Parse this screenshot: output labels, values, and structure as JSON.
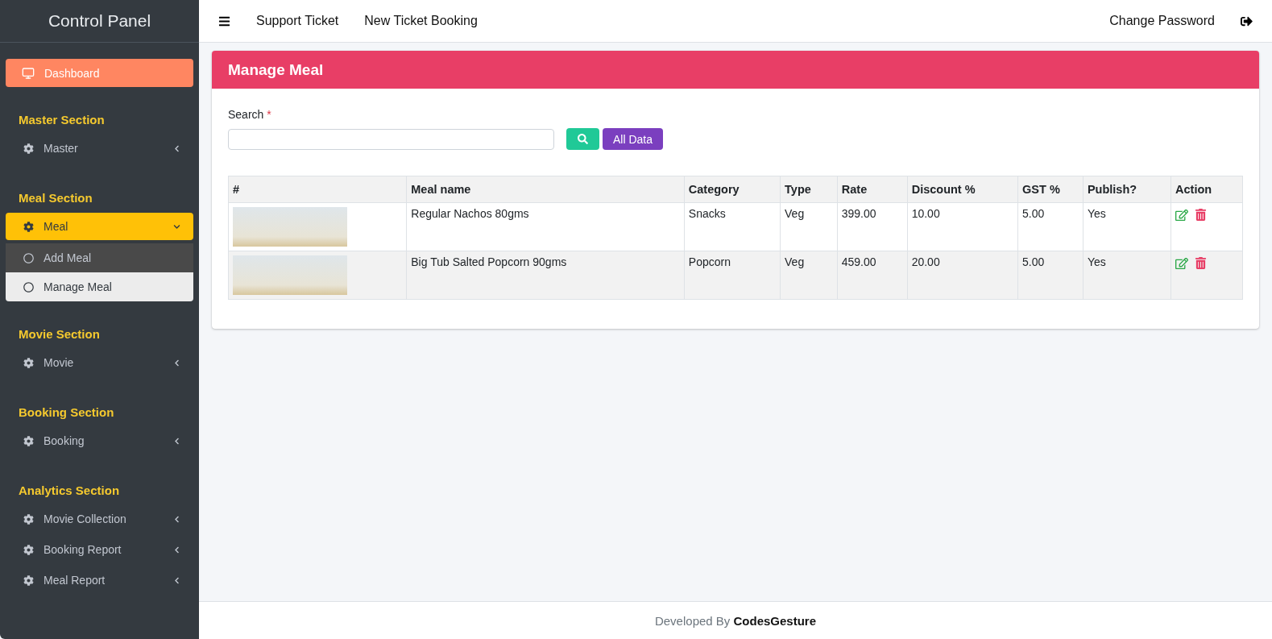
{
  "sidebar": {
    "title": "Control Panel",
    "dashboard": {
      "label": "Dashboard",
      "selected": true
    },
    "sections": [
      {
        "title": "Master Section",
        "items": [
          {
            "label": "Master",
            "expanded": false
          }
        ]
      },
      {
        "title": "Meal Section",
        "items": [
          {
            "label": "Meal",
            "expanded": true,
            "children": [
              {
                "label": "Add Meal",
                "selected": false
              },
              {
                "label": "Manage Meal",
                "selected": true
              }
            ]
          }
        ]
      },
      {
        "title": "Movie Section",
        "items": [
          {
            "label": "Movie",
            "expanded": false
          }
        ]
      },
      {
        "title": "Booking Section",
        "items": [
          {
            "label": "Booking",
            "expanded": false
          }
        ]
      },
      {
        "title": "Analytics Section",
        "items": [
          {
            "label": "Movie Collection",
            "expanded": false
          },
          {
            "label": "Booking Report",
            "expanded": false
          },
          {
            "label": "Meal Report",
            "expanded": false
          }
        ]
      }
    ]
  },
  "topbar": {
    "links": [
      "Support Ticket",
      "New Ticket Booking"
    ],
    "right_link": "Change Password"
  },
  "card": {
    "title": "Manage Meal",
    "search": {
      "label": "Search",
      "required_mark": "*"
    },
    "all_data_button": "All Data",
    "table": {
      "columns": [
        "#",
        "Meal name",
        "Category",
        "Type",
        "Rate",
        "Discount %",
        "GST %",
        "Publish?",
        "Action"
      ],
      "rows": [
        {
          "meal_name": "Regular Nachos 80gms",
          "category": "Snacks",
          "type": "Veg",
          "rate": "399.00",
          "discount": "10.00",
          "gst": "5.00",
          "publish": "Yes"
        },
        {
          "meal_name": "Big Tub Salted Popcorn 90gms",
          "category": "Popcorn",
          "type": "Veg",
          "rate": "459.00",
          "discount": "20.00",
          "gst": "5.00",
          "publish": "Yes"
        }
      ]
    }
  },
  "footer": {
    "text": "Developed By **CodesGesture**"
  }
}
